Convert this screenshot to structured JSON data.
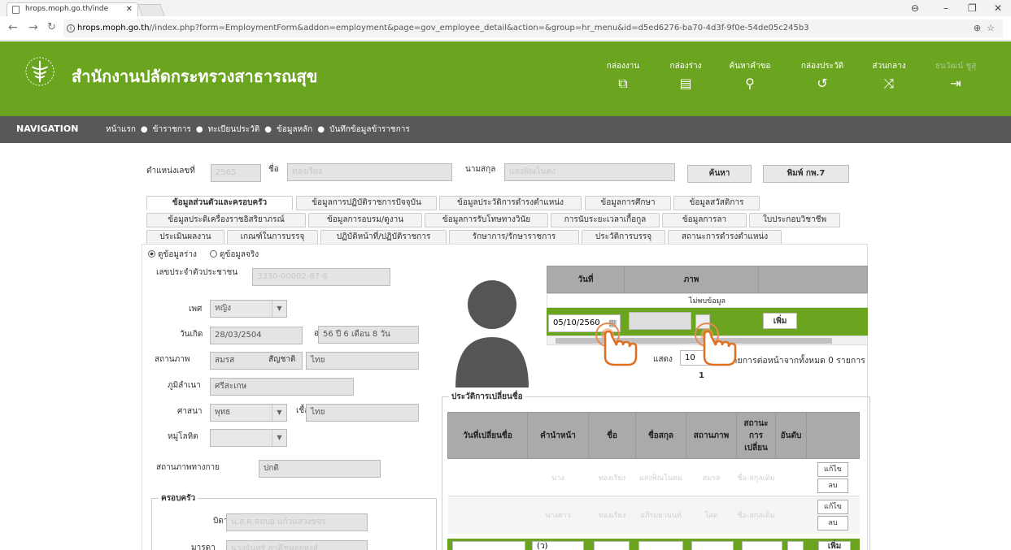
{
  "browser": {
    "tab_title": "hrops.moph.go.th/inde",
    "url_host": "hrops.moph.go.th",
    "url_path": "//index.php?form=EmploymentForm&addon=employment&page=gov_employee_detail&action=&group=hr_menu&id=d5ed6276-ba70-4d3f-9f0e-54de05c245b3"
  },
  "header": {
    "org_name": "สำนักงานปลัดกระทรวงสาธารณสุข",
    "nav": [
      {
        "label": "กล่องงาน",
        "icon": "copy-icon"
      },
      {
        "label": "กล่องร่าง",
        "icon": "document-icon"
      },
      {
        "label": "ค้นหาคำขอ",
        "icon": "search-icon"
      },
      {
        "label": "กล่องประวัติ",
        "icon": "history-icon"
      },
      {
        "label": "ส่วนกลาง",
        "icon": "shuffle-icon"
      },
      {
        "label": "ธนวัฒน์ ชูสุ",
        "icon": "logout-icon"
      }
    ]
  },
  "navbar": {
    "label": "NAVIGATION",
    "crumbs": [
      "หน้าแรก",
      "ข้าราชการ",
      "ทะเบียนประวัติ",
      "ข้อมูลหลัก",
      "บันทึกข้อมูลข้าราชการ"
    ]
  },
  "search": {
    "position_label": "ตำแหน่งเลขที่",
    "position_value": "2565",
    "name_label": "ชื่อ",
    "name_value": "ทองเรียง",
    "surname_label": "นามสกุล",
    "surname_value": "แสงพิณโนคง",
    "search_button": "ค้นหา",
    "print_button": "พิมพ์ กพ.7"
  },
  "tabs": {
    "row1": [
      "ข้อมูลส่วนตัวและครอบครัว",
      "ข้อมูลการปฏิบัติราชการปัจจุบัน",
      "ข้อมูลประวัติการดำรงตำแหน่ง",
      "ข้อมูลการศึกษา",
      "ข้อมูลสวัสดิการ"
    ],
    "row2": [
      "ข้อมูลประดิเครื่องราชอิสริยาภรณ์",
      "ข้อมูลการอบรม/ดูงาน",
      "ข้อมูลการรับโทษทางวินัย",
      "การนับระยะเวลาเกื้อกูล",
      "ข้อมูลการลา",
      "ใบประกอบวิชาชีพ"
    ],
    "row3": [
      "ประเมินผลงาน",
      "เกณฑ์ในการบรรจุ",
      "ปฏิบัติหน้าที่/ปฏิบัติราชการ",
      "รักษาการ/รักษาราชการ",
      "ประวัติการบรรจุ",
      "สถานะการดำรงตำแหน่ง"
    ]
  },
  "view_mode": {
    "draft_label": "ดูข้อมูลร่าง",
    "real_label": "ดูข้อมูลจริง",
    "selected": "draft"
  },
  "personal": {
    "id_label": "เลขประจำตัวประชาชน",
    "id_value": "3330-00002-87-6",
    "gender_label": "เพศ",
    "gender_value": "หญิง",
    "dob_label": "วันเกิด",
    "dob_value": "28/03/2504",
    "age_label": "อายุ",
    "age_value": "56 ปี 6 เดือน 8 วัน",
    "marital_label": "สถานภาพ",
    "marital_value": "สมรส",
    "nationality_label": "สัญชาติ",
    "nationality_value": "ไทย",
    "hometown_label": "ภูมิลำเนา",
    "hometown_value": "ศรีสะเกษ",
    "religion_label": "ศาสนา",
    "religion_value": "พุทธ",
    "race_label": "เชื้อชาติ",
    "race_value": "ไทย",
    "blood_label": "หมู่โลหิต",
    "blood_value": "",
    "military_label": "สถานภาพทางกาย",
    "military_value": "ปกติ"
  },
  "family": {
    "legend": "ครอบครัว",
    "father_label": "บิดา",
    "father_value": "น.ส.ต.สมบอ แก้วแสวงขจร",
    "mother_label": "มารดา",
    "mother_value": "นางจันทร์ ภาคีชพลยหงส์"
  },
  "photo_table": {
    "col_date": "วันที่",
    "col_photo": "ภาพ",
    "no_data": "ไม่พบข้อมูล",
    "date_value": "05/10/2560",
    "add_button": "เพิ่ม",
    "show_label": "แสดง",
    "page_size": "10",
    "paging_text": "รายการต่อหน้าจากทั้งหมด 0 รายการ",
    "page": "1"
  },
  "name_history": {
    "legend": "ประวัติการเปลี่ยนชื่อ",
    "headers": [
      "วันที่เปลี่ยนชื่อ",
      "คำนำหน้า",
      "ชื่อ",
      "ชื่อสกุล",
      "สถานภาพ",
      "สถานะ การ เปลี่ยน",
      "อันดับ"
    ],
    "rows": [
      {
        "cells": [
          "",
          "นาง",
          "ทองเรียง",
          "แสงพิณโนคม",
          "สมรส",
          "ชื่อ-สกุลเดิม",
          ""
        ]
      },
      {
        "cells": [
          "",
          "นางสาว",
          "ทองเรียง",
          "อภิรมยานนท์",
          "โสด",
          "ชื่อ-สกุลเดิม",
          ""
        ]
      }
    ],
    "edit_label": "แก้ไข",
    "delete_label": "ลบ",
    "new_row": {
      "prefix_placeholder": "(ว)",
      "add_button": "เพิ่ม"
    }
  }
}
